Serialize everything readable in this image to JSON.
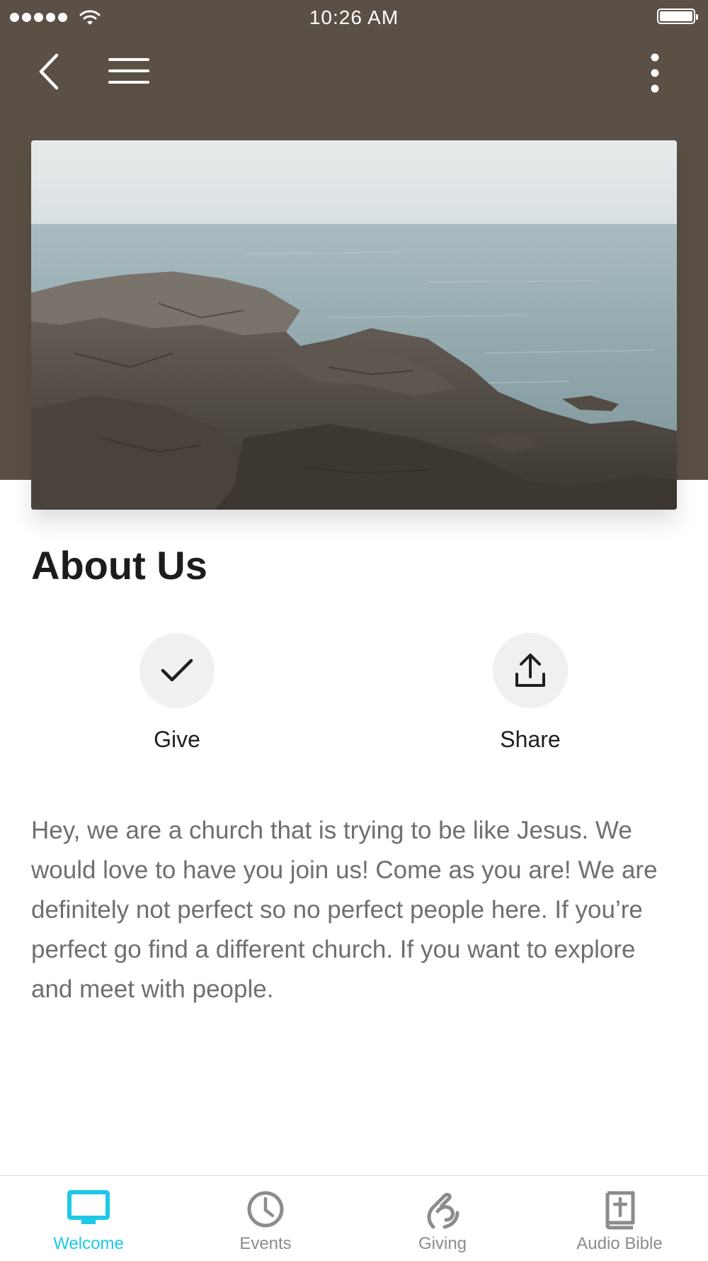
{
  "status_bar": {
    "time": "10:26 AM",
    "signal_icon": "cellular-signal-icon",
    "wifi_icon": "wifi-icon",
    "battery_icon": "battery-full-icon"
  },
  "nav": {
    "back_icon": "chevron-left-icon",
    "menu_icon": "hamburger-menu-icon",
    "more_icon": "vertical-ellipsis-icon"
  },
  "hero": {
    "image": "rocky-coastline-photo"
  },
  "page": {
    "title": "About Us"
  },
  "actions": [
    {
      "label": "Give",
      "icon": "checkmark-icon"
    },
    {
      "label": "Share",
      "icon": "share-upload-icon"
    }
  ],
  "about_text": "Hey, we are a church that is trying to be like Jesus. We would love to have you join us! Come as you are! We are definitely not perfect so no perfect people here. If you’re perfect go find a different church. If you want to explore and meet with people.",
  "tabs": [
    {
      "label": "Welcome",
      "icon": "monitor-icon",
      "active": true
    },
    {
      "label": "Events",
      "icon": "clock-icon",
      "active": false
    },
    {
      "label": "Giving",
      "icon": "giving-hand-icon",
      "active": false
    },
    {
      "label": "Audio Bible",
      "icon": "bible-book-icon",
      "active": false
    }
  ],
  "colors": {
    "header_background": "#5a5045",
    "accent": "#1ec8e6",
    "body_text": "#6f6f6f",
    "inactive_tab": "#8c8c8c"
  }
}
